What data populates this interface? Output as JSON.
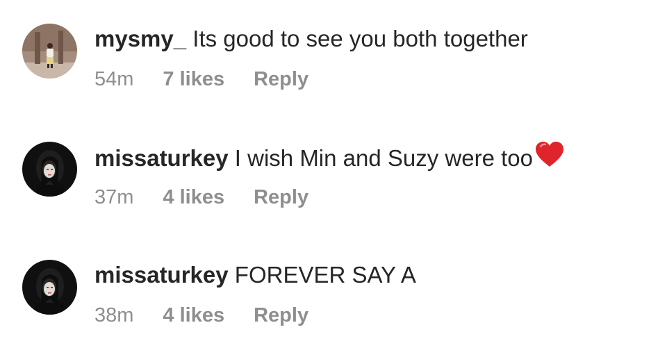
{
  "comments": [
    {
      "username": "mysmy_",
      "text": "Its good to see you both together",
      "time": "54m",
      "likes": "7 likes",
      "reply": "Reply",
      "avatar": "person-standing-avatar",
      "emoji": ""
    },
    {
      "username": "missaturkey",
      "text": "I wish Min and Suzy were too",
      "time": "37m",
      "likes": "4 likes",
      "reply": "Reply",
      "avatar": "dark-portrait-avatar",
      "emoji": "red-heart-icon"
    },
    {
      "username": "missaturkey",
      "text": "FOREVER SAY A",
      "time": "38m",
      "likes": "4 likes",
      "reply": "Reply",
      "avatar": "dark-portrait-avatar",
      "emoji": ""
    }
  ],
  "colors": {
    "text": "#262626",
    "meta": "#8e8e8e",
    "heart": "#e0242b"
  }
}
